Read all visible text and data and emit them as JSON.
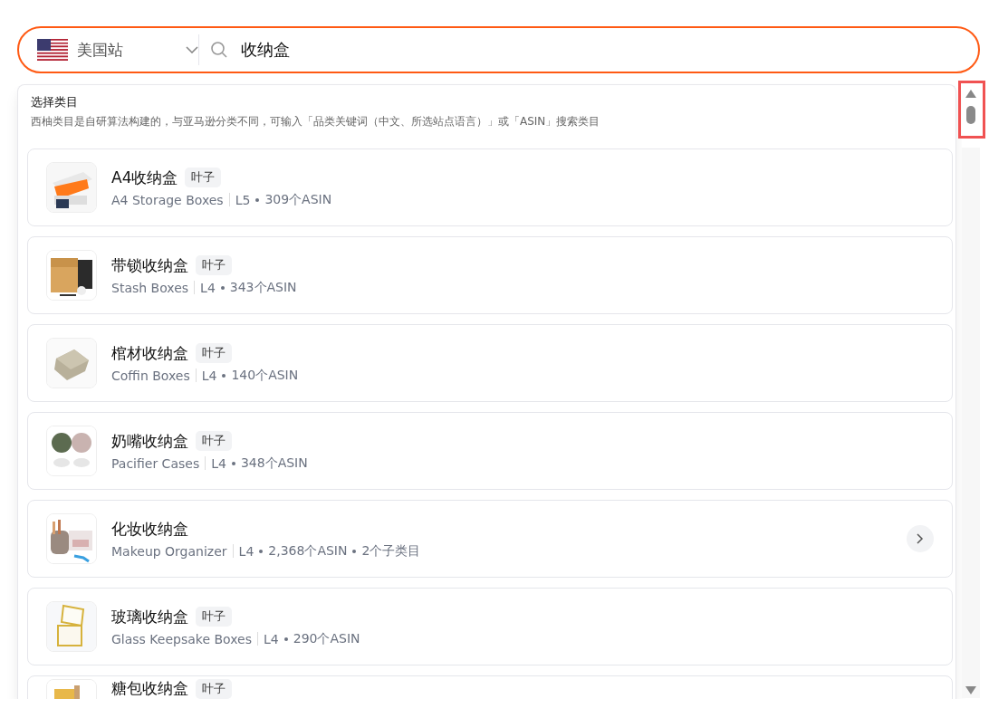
{
  "search": {
    "site": "美国站",
    "query": "收纳盒"
  },
  "panel": {
    "title": "选择类目",
    "description": "西柚类目是自研算法构建的，与亚马逊分类不同，可输入「品类关键词（中文、所选站点语言）」或「ASIN」搜索类目"
  },
  "categories": [
    {
      "title": "A4收纳盒",
      "tag": "叶子",
      "english": "A4 Storage Boxes",
      "level": "L5",
      "asins": "309个ASIN",
      "has_children": false
    },
    {
      "title": "带锁收纳盒",
      "tag": "叶子",
      "english": "Stash Boxes",
      "level": "L4",
      "asins": "343个ASIN",
      "has_children": false
    },
    {
      "title": "棺材收纳盒",
      "tag": "叶子",
      "english": "Coffin Boxes",
      "level": "L4",
      "asins": "140个ASIN",
      "has_children": false
    },
    {
      "title": "奶嘴收纳盒",
      "tag": "叶子",
      "english": "Pacifier Cases",
      "level": "L4",
      "asins": "348个ASIN",
      "has_children": false
    },
    {
      "title": "化妆收纳盒",
      "english": "Makeup Organizer",
      "level": "L4",
      "asins": "2,368个ASIN",
      "subcategories": "2个子类目",
      "has_children": true
    },
    {
      "title": "玻璃收纳盒",
      "tag": "叶子",
      "english": "Glass Keepsake Boxes",
      "level": "L4",
      "asins": "290个ASIN",
      "has_children": false
    },
    {
      "title": "糖包收纳盒",
      "tag": "叶子",
      "has_children": false
    }
  ]
}
